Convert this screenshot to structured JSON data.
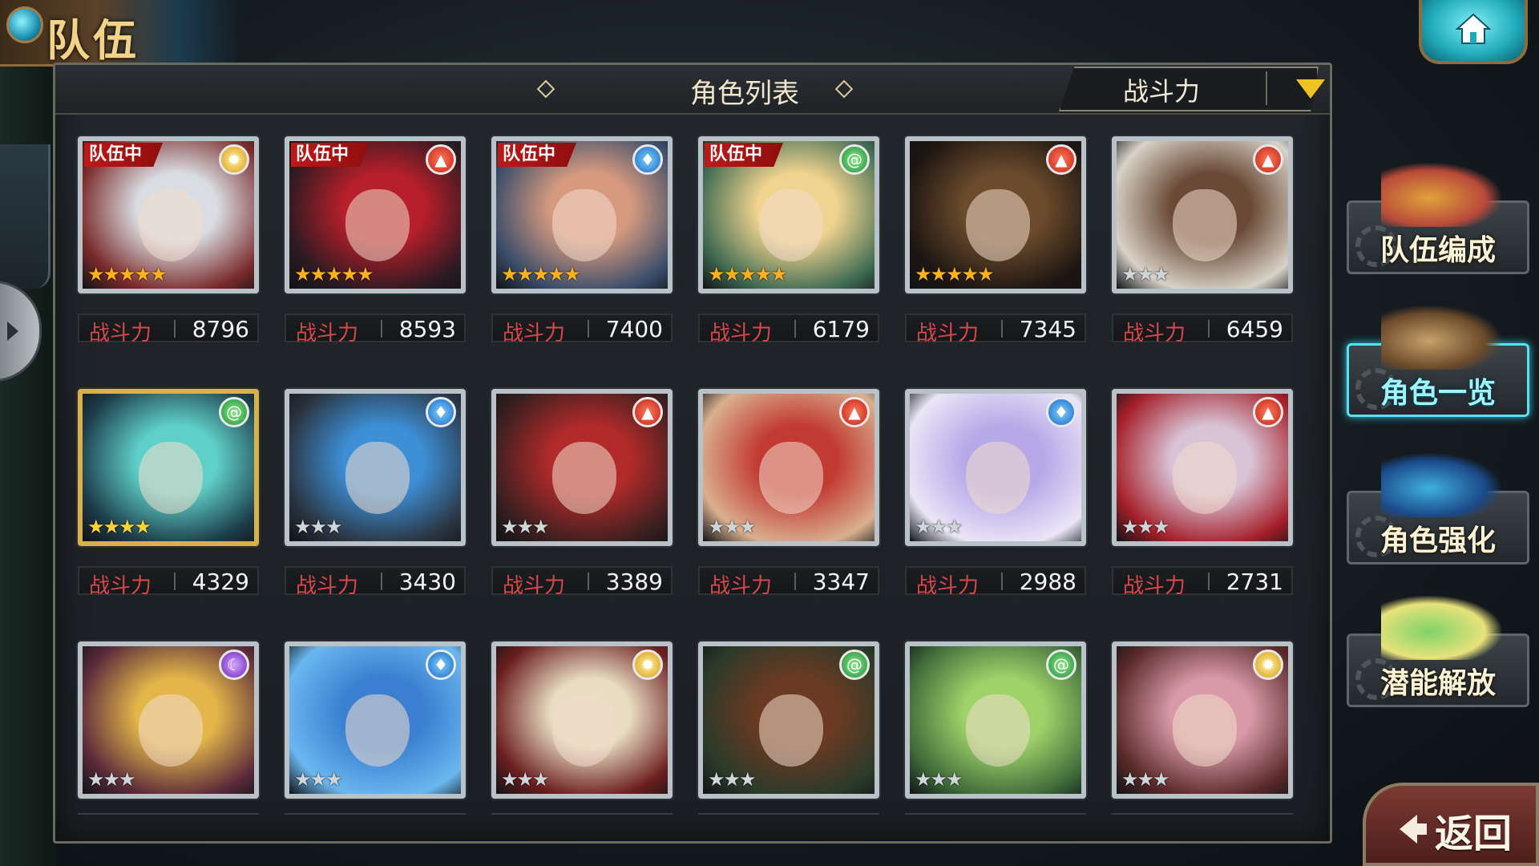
{
  "screen": {
    "title": "队伍"
  },
  "header": {
    "title": "角色列表",
    "sort_label": "战斗力"
  },
  "power_label": "战斗力",
  "team_badge": "队伍中",
  "cards": [
    {
      "in_team": true,
      "element": "light",
      "stars": 5,
      "power": "8796",
      "frame": "silver",
      "palette": [
        "#d9dde2",
        "#7a2a2a"
      ]
    },
    {
      "in_team": true,
      "element": "fire",
      "stars": 5,
      "power": "8593",
      "frame": "silver",
      "palette": [
        "#b71f2a",
        "#2a1a22"
      ]
    },
    {
      "in_team": true,
      "element": "water",
      "stars": 5,
      "power": "7400",
      "frame": "silver",
      "palette": [
        "#d79a7f",
        "#3a4d6a"
      ]
    },
    {
      "in_team": true,
      "element": "wind",
      "stars": 5,
      "power": "6179",
      "frame": "silver",
      "palette": [
        "#f0d38f",
        "#3f6b52"
      ]
    },
    {
      "in_team": false,
      "element": "fire",
      "stars": 5,
      "power": "7345",
      "frame": "silver",
      "palette": [
        "#6b4b2c",
        "#1d1612"
      ]
    },
    {
      "in_team": false,
      "element": "fire",
      "stars": 3,
      "power": "6459",
      "frame": "silver",
      "palette": [
        "#6a4a36",
        "#d8d2c8"
      ]
    },
    {
      "in_team": false,
      "element": "wind",
      "stars": 4,
      "power": "4329",
      "frame": "gold",
      "palette": [
        "#5fd0c8",
        "#1c3b4a"
      ]
    },
    {
      "in_team": false,
      "element": "water",
      "stars": 3,
      "power": "3430",
      "frame": "silver",
      "palette": [
        "#3d8fd6",
        "#2a3440"
      ]
    },
    {
      "in_team": false,
      "element": "fire",
      "stars": 3,
      "power": "3389",
      "frame": "silver",
      "palette": [
        "#b22a2a",
        "#3a1f1f"
      ]
    },
    {
      "in_team": false,
      "element": "fire",
      "stars": 3,
      "power": "3347",
      "frame": "silver",
      "palette": [
        "#c23a32",
        "#d9b08f"
      ]
    },
    {
      "in_team": false,
      "element": "water",
      "stars": 3,
      "power": "2988",
      "frame": "silver",
      "palette": [
        "#b7a8e8",
        "#eae6f6"
      ]
    },
    {
      "in_team": false,
      "element": "fire",
      "stars": 3,
      "power": "2731",
      "frame": "silver",
      "palette": [
        "#d8c4d6",
        "#a51f2a"
      ]
    },
    {
      "in_team": false,
      "element": "dark",
      "stars": 3,
      "power": "",
      "frame": "silver",
      "palette": [
        "#e3b64a",
        "#5a2a3a"
      ]
    },
    {
      "in_team": false,
      "element": "water",
      "stars": 3,
      "power": "",
      "frame": "silver",
      "palette": [
        "#3a7fd0",
        "#6ab7ef"
      ]
    },
    {
      "in_team": false,
      "element": "light",
      "stars": 3,
      "power": "",
      "frame": "silver",
      "palette": [
        "#e8dcc2",
        "#6b1e1e"
      ]
    },
    {
      "in_team": false,
      "element": "wind",
      "stars": 3,
      "power": "",
      "frame": "silver",
      "palette": [
        "#6b3a22",
        "#2a3a2a"
      ]
    },
    {
      "in_team": false,
      "element": "wind",
      "stars": 3,
      "power": "",
      "frame": "silver",
      "palette": [
        "#9fd36a",
        "#3f6b3a"
      ]
    },
    {
      "in_team": false,
      "element": "light",
      "stars": 3,
      "power": "",
      "frame": "silver",
      "palette": [
        "#d89aa8",
        "#5a2a2a"
      ]
    }
  ],
  "side_menu": [
    {
      "label": "队伍编成",
      "icon": "team-formation-icon",
      "active": false
    },
    {
      "label": "角色一览",
      "icon": "character-book-icon",
      "active": true
    },
    {
      "label": "角色强化",
      "icon": "enhance-crystal-icon",
      "active": false
    },
    {
      "label": "潜能解放",
      "icon": "potential-orb-icon",
      "active": false
    }
  ],
  "back_button": {
    "label": "返回"
  },
  "element_icons": {
    "fire": "fire-icon",
    "water": "water-drop-icon",
    "wind": "wind-swirl-icon",
    "light": "sun-icon",
    "dark": "moon-icon"
  },
  "colors": {
    "accent_cyan": "#58e0f0",
    "power_label": "#d8474a",
    "team_badge": "#c01818",
    "sort_arrow": "#f0c321"
  }
}
